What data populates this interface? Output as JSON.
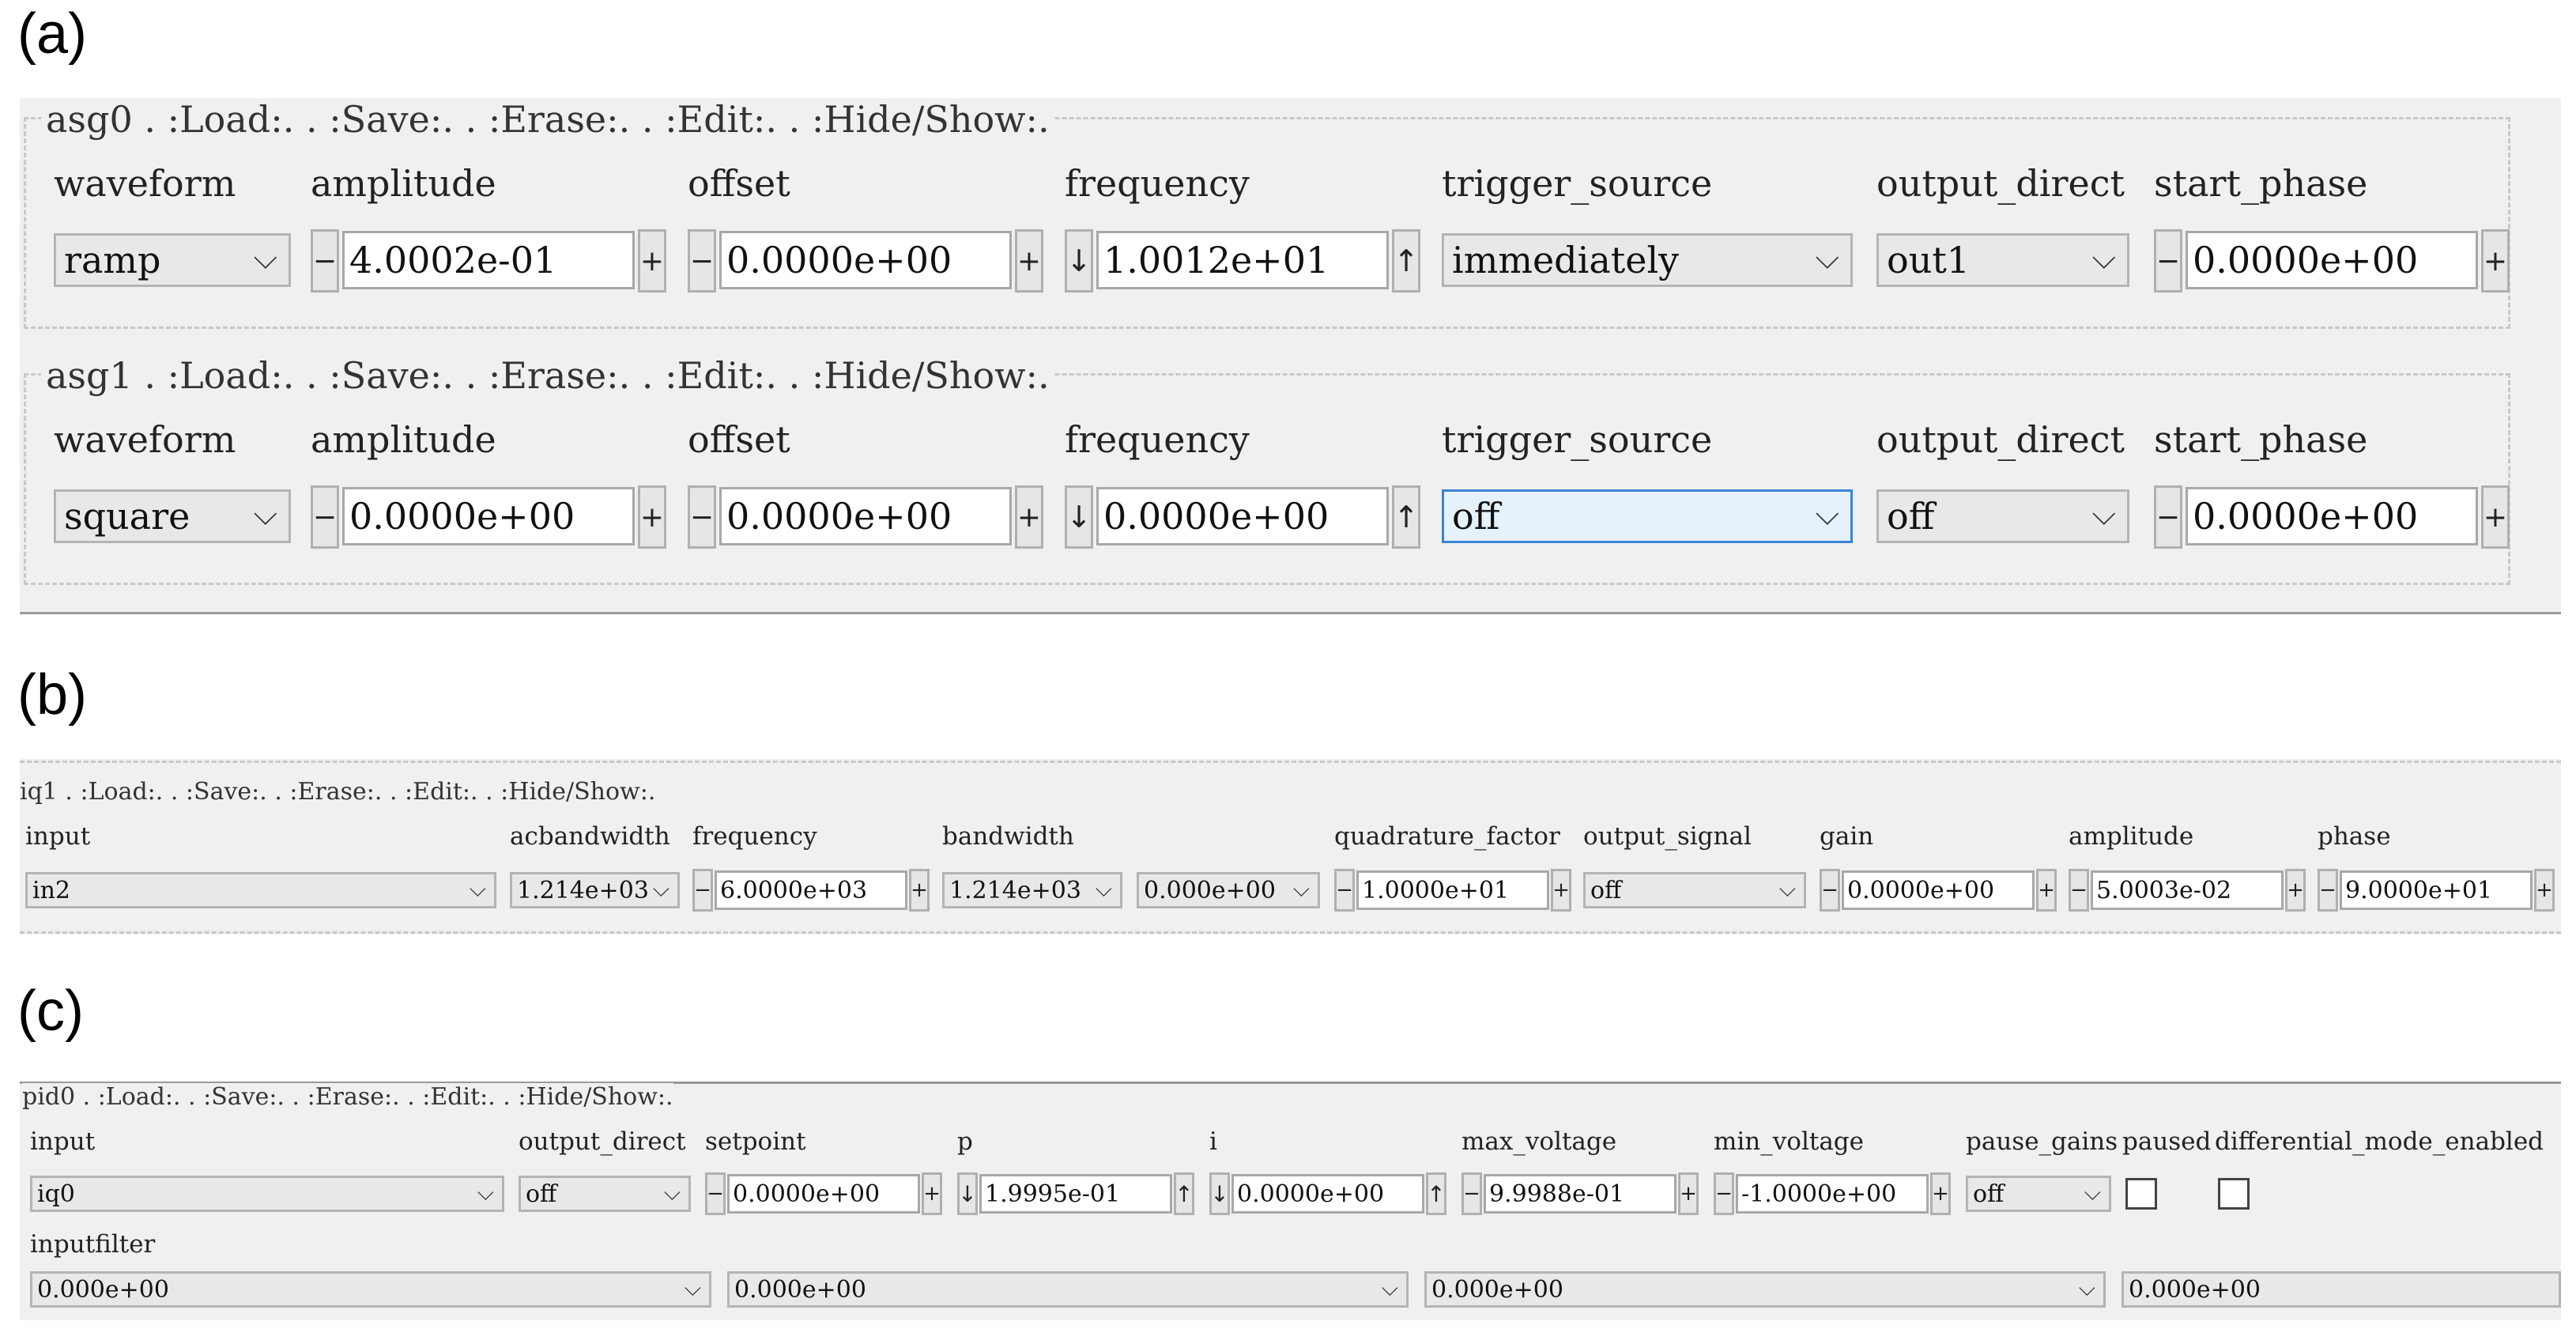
{
  "panels": {
    "a": "(a)",
    "b": "(b)",
    "c": "(c)"
  },
  "asg0": {
    "legend": "asg0 . :Load:.    . :Save:.    . :Erase:.    . :Edit:.    . :Hide/Show:.",
    "labels": {
      "waveform": "waveform",
      "amplitude": "amplitude",
      "offset": "offset",
      "frequency": "frequency",
      "trigger_source": "trigger_source",
      "output_direct": "output_direct",
      "start_phase": "start_phase"
    },
    "waveform": "ramp",
    "amplitude": "4.0002e-01",
    "offset": "0.0000e+00",
    "frequency": "1.0012e+01",
    "trigger_source": "immediately",
    "output_direct": "out1",
    "start_phase": "0.0000e+00"
  },
  "asg1": {
    "legend": "asg1 . :Load:.    . :Save:.    . :Erase:.    . :Edit:.    . :Hide/Show:.",
    "labels": {
      "waveform": "waveform",
      "amplitude": "amplitude",
      "offset": "offset",
      "frequency": "frequency",
      "trigger_source": "trigger_source",
      "output_direct": "output_direct",
      "start_phase": "start_phase"
    },
    "waveform": "square",
    "amplitude": "0.0000e+00",
    "offset": "0.0000e+00",
    "frequency": "0.0000e+00",
    "trigger_source": "off",
    "output_direct": "off",
    "start_phase": "0.0000e+00"
  },
  "iq1": {
    "legend": "iq1 . :Load:.    . :Save:.    . :Erase:.    . :Edit:.    . :Hide/Show:.",
    "labels": {
      "input": "input",
      "acbandwidth": "acbandwidth",
      "frequency": "frequency",
      "bandwidth": "bandwidth",
      "quadrature_factor": "quadrature_factor",
      "output_signal": "output_signal",
      "gain": "gain",
      "amplitude": "amplitude",
      "phase": "phase"
    },
    "input": "in2",
    "acbandwidth": "1.214e+03",
    "frequency": "6.0000e+03",
    "bandwidth_1": "1.214e+03",
    "bandwidth_2": "0.000e+00",
    "quadrature_factor": "1.0000e+01",
    "output_signal": "off",
    "gain": "0.0000e+00",
    "amplitude": "5.0003e-02",
    "phase": "9.0000e+01"
  },
  "pid0": {
    "legend": "pid0 . :Load:.    . :Save:.    . :Erase:.    . :Edit:.    . :Hide/Show:.",
    "labels": {
      "input": "input",
      "output_direct": "output_direct",
      "setpoint": "setpoint",
      "p": "p",
      "i": "i",
      "max_voltage": "max_voltage",
      "min_voltage": "min_voltage",
      "pause_gains": "pause_gains",
      "paused": "paused",
      "differential_mode_enabled": "differential_mode_enabled",
      "inputfilter": "inputfilter"
    },
    "input": "iq0",
    "output_direct": "off",
    "setpoint": "0.0000e+00",
    "p": "1.9995e-01",
    "i": "0.0000e+00",
    "max_voltage": "9.9988e-01",
    "min_voltage": "-1.0000e+00",
    "pause_gains": "off",
    "paused": false,
    "differential_mode_enabled": false,
    "inputfilter": [
      "0.000e+00",
      "0.000e+00",
      "0.000e+00",
      "0.000e+00"
    ]
  },
  "glyphs": {
    "minus": "−",
    "plus": "+",
    "down": "↓",
    "up": "↑",
    "chevron": "⌵"
  }
}
